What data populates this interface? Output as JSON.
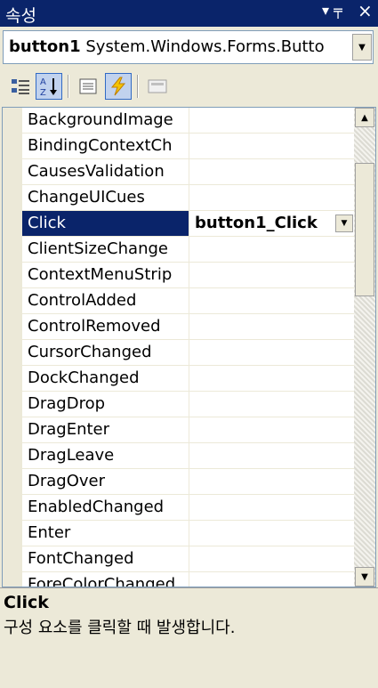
{
  "window": {
    "title": "속성",
    "pin_glyph": "▾ ╤",
    "close_glyph": "×"
  },
  "object_selector": {
    "name": "button1",
    "type": "System.Windows.Forms.Butto"
  },
  "toolbar": {
    "buttons": [
      {
        "icon": "categorized-icon",
        "active": false
      },
      {
        "icon": "alphabetical-icon",
        "active": true
      },
      {
        "icon": "properties-icon",
        "active": false
      },
      {
        "icon": "events-icon",
        "active": true
      },
      {
        "icon": "property-pages-icon",
        "active": false
      }
    ]
  },
  "grid": {
    "rows": [
      {
        "name": "BackgroundImage",
        "value": ""
      },
      {
        "name": "BindingContextCh",
        "value": ""
      },
      {
        "name": "CausesValidation",
        "value": ""
      },
      {
        "name": "ChangeUICues",
        "value": ""
      },
      {
        "name": "Click",
        "value": "button1_Click",
        "selected": true
      },
      {
        "name": "ClientSizeChange",
        "value": ""
      },
      {
        "name": "ContextMenuStrip",
        "value": ""
      },
      {
        "name": "ControlAdded",
        "value": ""
      },
      {
        "name": "ControlRemoved",
        "value": ""
      },
      {
        "name": "CursorChanged",
        "value": ""
      },
      {
        "name": "DockChanged",
        "value": ""
      },
      {
        "name": "DragDrop",
        "value": ""
      },
      {
        "name": "DragEnter",
        "value": ""
      },
      {
        "name": "DragLeave",
        "value": ""
      },
      {
        "name": "DragOver",
        "value": ""
      },
      {
        "name": "EnabledChanged",
        "value": ""
      },
      {
        "name": "Enter",
        "value": ""
      },
      {
        "name": "FontChanged",
        "value": ""
      },
      {
        "name": "ForeColorChanged",
        "value": ""
      }
    ]
  },
  "help": {
    "title": "Click",
    "description": "구성 요소를 클릭할 때 발생합니다."
  },
  "colors": {
    "titlebar": "#0a246a",
    "selection": "#0a246a",
    "panel": "#ece9d8"
  }
}
